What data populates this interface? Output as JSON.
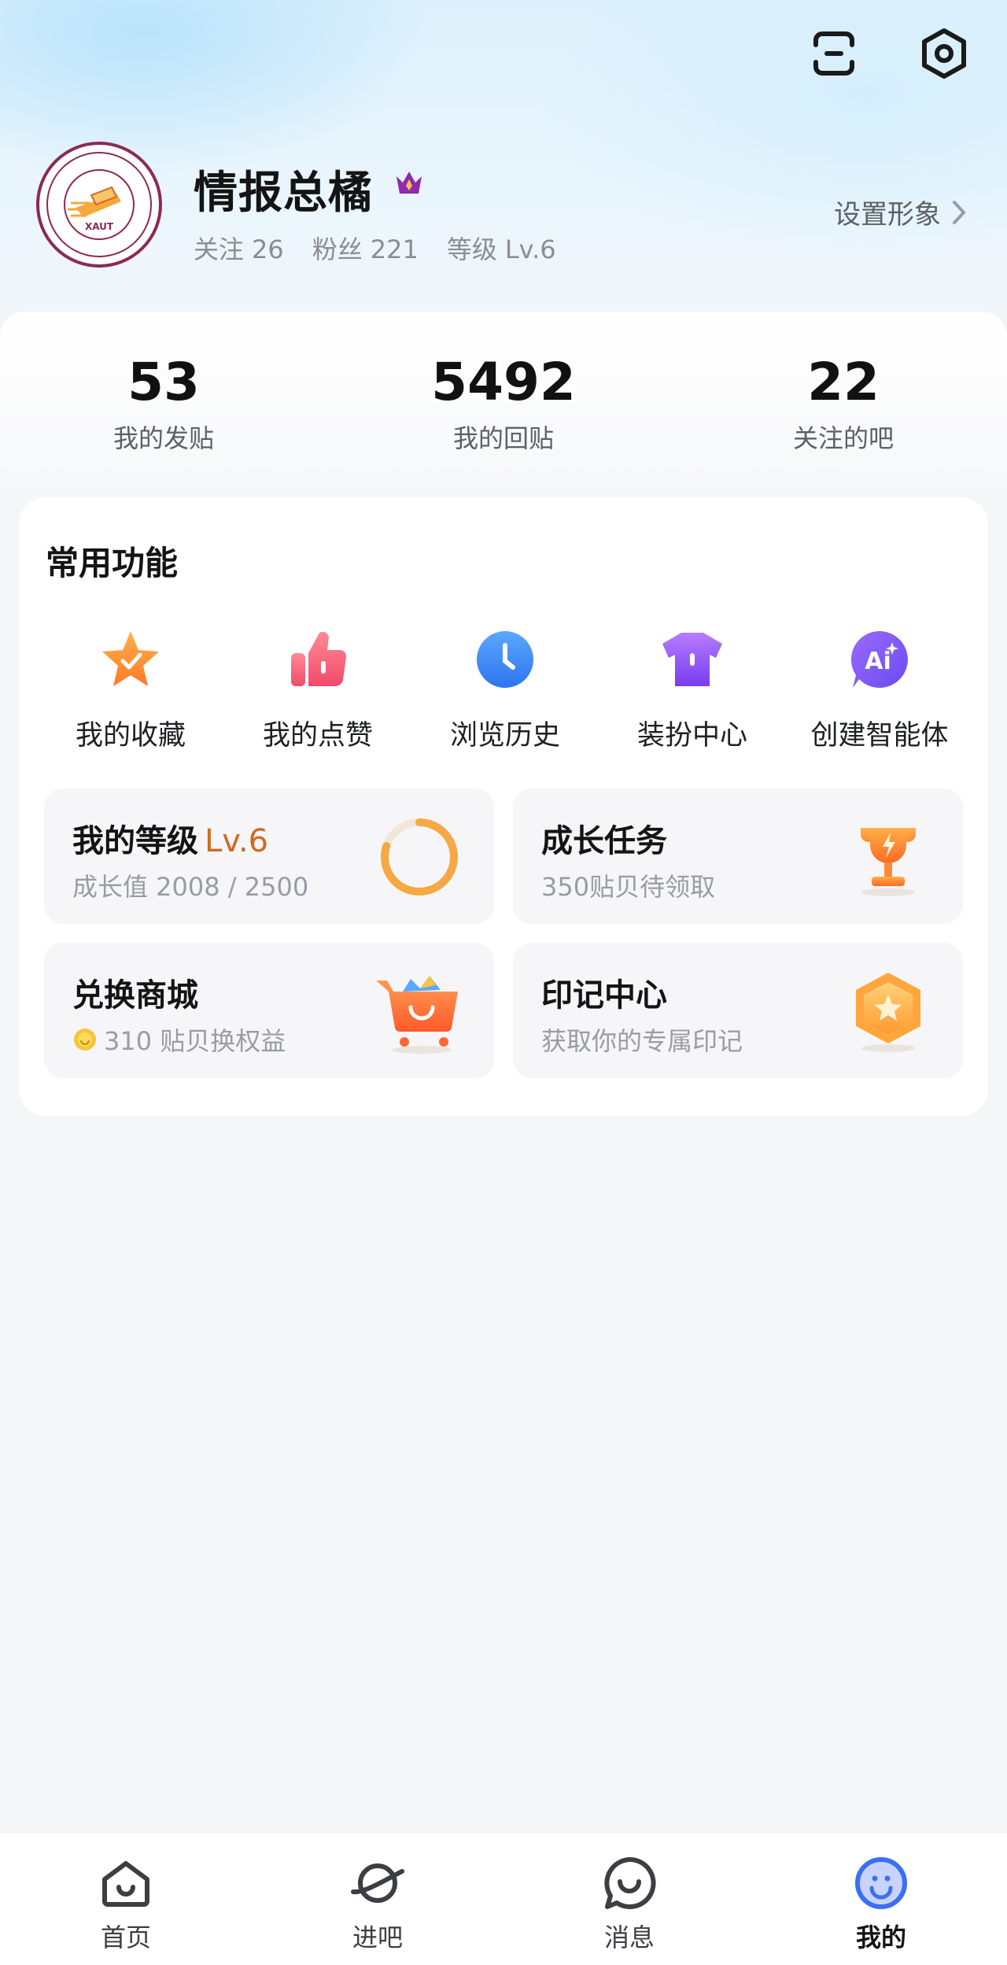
{
  "profile": {
    "username": "情报总橘",
    "avatar_logo_text": "XAUT",
    "following_label": "关注",
    "following_count": "26",
    "fans_label": "粉丝",
    "fans_count": "221",
    "level_label": "等级",
    "level_value": "Lv.6",
    "set_avatar_label": "设置形象"
  },
  "counts": [
    {
      "value": "53",
      "label": "我的发贴"
    },
    {
      "value": "5492",
      "label": "我的回贴"
    },
    {
      "value": "22",
      "label": "关注的吧"
    }
  ],
  "functions": {
    "title": "常用功能",
    "items": [
      {
        "label": "我的收藏",
        "icon": "star-icon"
      },
      {
        "label": "我的点赞",
        "icon": "thumbs-up-icon"
      },
      {
        "label": "浏览历史",
        "icon": "clock-icon"
      },
      {
        "label": "装扮中心",
        "icon": "tshirt-icon"
      },
      {
        "label": "创建智能体",
        "icon": "ai-icon"
      }
    ]
  },
  "tiles": {
    "level": {
      "title": "我的等级",
      "level": "Lv.6",
      "subtitle": "成长值 2008 / 2500",
      "progress": 0.8
    },
    "growth": {
      "title": "成长任务",
      "subtitle": "350贴贝待领取"
    },
    "mall": {
      "title": "兑换商城",
      "subtitle": "310 贴贝换权益"
    },
    "badge": {
      "title": "印记中心",
      "subtitle": "获取你的专属印记"
    }
  },
  "tabbar": [
    {
      "label": "首页",
      "icon": "home-icon"
    },
    {
      "label": "进吧",
      "icon": "planet-icon"
    },
    {
      "label": "消息",
      "icon": "message-icon"
    },
    {
      "label": "我的",
      "icon": "profile-smile-icon"
    }
  ],
  "colors": {
    "accent_orange": "#d2691e",
    "active_blue": "#3b6ff5"
  }
}
